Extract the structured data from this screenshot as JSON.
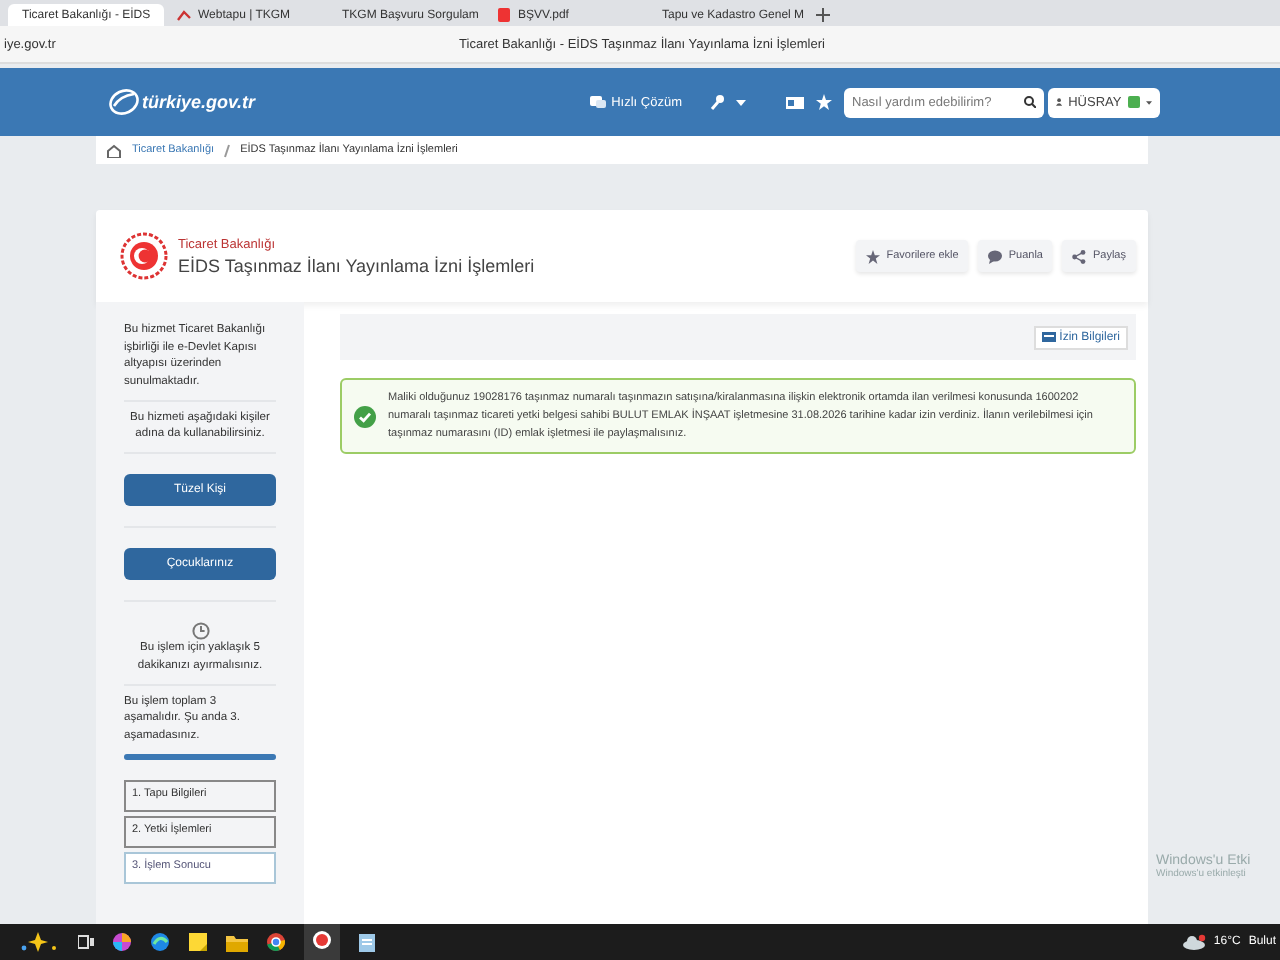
{
  "browser": {
    "tabs": [
      {
        "label": "Ticaret Bakanlığı - EİDS",
        "selected": true,
        "kind": "page"
      },
      {
        "label": "Webtapu | TKGM",
        "selected": false,
        "kind": "page"
      },
      {
        "label": "TKGM Başvuru Sorgulam",
        "selected": false,
        "kind": "doc"
      },
      {
        "label": "BŞVV.pdf",
        "selected": false,
        "kind": "pdf"
      },
      {
        "label": "Tapu ve Kadastro Genel M",
        "selected": false,
        "kind": "page"
      }
    ],
    "address": "iye.gov.tr",
    "page_title": "Ticaret Bakanlığı - EİDS Taşınmaz İlanı Yayınlama İzni İşlemleri"
  },
  "header": {
    "logo": "türkiye.gov.tr",
    "quick_solution": "Hızlı Çözüm",
    "search": {
      "placeholder": "Nasıl yardım edebilirim?"
    },
    "user": "HÜSRAY"
  },
  "breadcrumb": [
    "Ticaret Bakanlığı",
    "EİDS Taşınmaz İlanı Yayınlama İzni İşlemleri"
  ],
  "service": {
    "ministry": "Ticaret Bakanlığı",
    "title": "EİDS Taşınmaz İlanı Yayınlama İzni İşlemleri",
    "actions": [
      {
        "kind": "star",
        "label": "Favorilere ekle"
      },
      {
        "kind": "comment",
        "label": "Puanla"
      },
      {
        "kind": "share",
        "label": "Paylaş"
      }
    ]
  },
  "sidebar": {
    "intro": "Bu hizmet Ticaret Bakanlığı işbirliği ile e-Devlet Kapısı altyapısı üzerinden sunulmaktadır.",
    "on_behalf": "Bu hizmeti aşağıdaki kişiler adına da kullanabilirsiniz.",
    "buttons": [
      "Tüzel Kişi",
      "Çocuklarınız"
    ],
    "duration": "Bu işlem için yaklaşık 5 dakikanızı ayırmalısınız.",
    "progress_text": "Bu işlem toplam 3 aşamalıdır. Şu anda 3. aşamadasınız.",
    "progress": {
      "level": 1
    },
    "steps": [
      {
        "label": "1. Tapu Bilgileri",
        "selected": false
      },
      {
        "label": "2. Yetki İşlemleri",
        "selected": false
      },
      {
        "label": "3. İşlem Sonucu",
        "selected": true
      }
    ]
  },
  "main": {
    "info_button": "İzin Bilgileri",
    "alert": {
      "kind": "success",
      "text": "Maliki olduğunuz 19028176 taşınmaz numaralı taşınmazın satışına/kiralanmasına ilişkin elektronik ortamda ilan verilmesi konusunda 1600202 numaralı taşınmaz ticareti yetki belgesi sahibi BULUT EMLAK İNŞAAT işletmesine 31.08.2026 tarihine kadar izin verdiniz. İlanın verilebilmesi için taşınmaz numarasını (ID) emlak işletmesi ile paylaşmalısınız."
    }
  },
  "os_notice": [
    "Windows'u Etki",
    "Windows'u etkinleşti"
  ],
  "taskbar": {
    "weather": "16°C",
    "status": "Bulut"
  }
}
